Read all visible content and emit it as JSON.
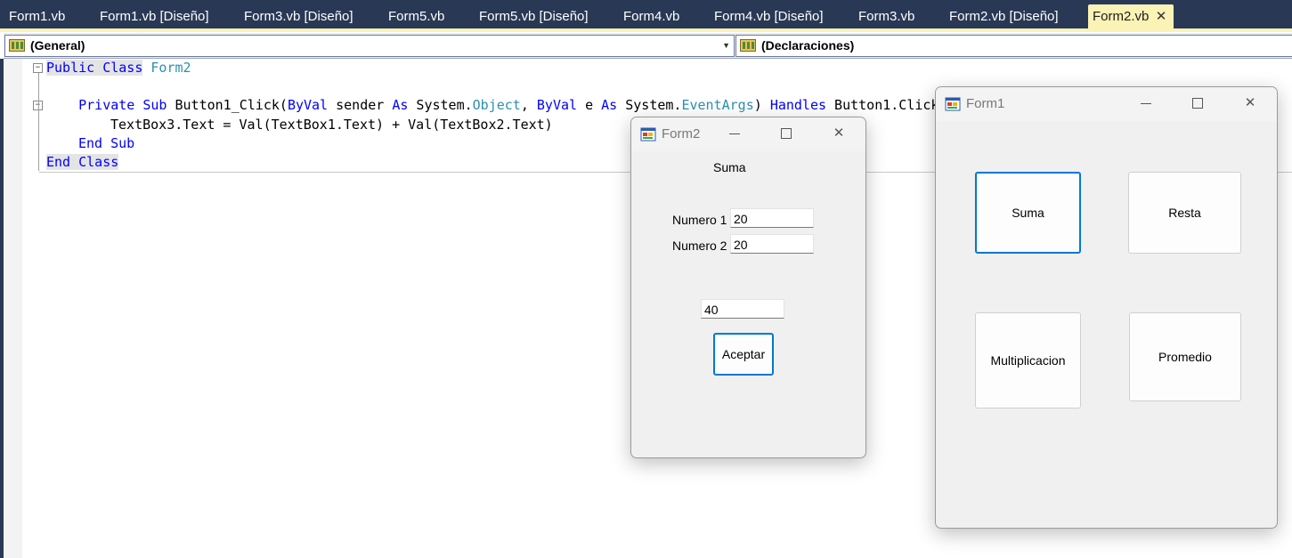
{
  "tabs": [
    {
      "label": "Form1.vb"
    },
    {
      "label": "Form1.vb [Diseño]"
    },
    {
      "label": "Form3.vb [Diseño]"
    },
    {
      "label": "Form5.vb"
    },
    {
      "label": "Form5.vb [Diseño]"
    },
    {
      "label": "Form4.vb"
    },
    {
      "label": "Form4.vb [Diseño]"
    },
    {
      "label": "Form3.vb"
    },
    {
      "label": "Form2.vb [Diseño]"
    },
    {
      "label": "Form2.vb",
      "close": "✕"
    }
  ],
  "navbar": {
    "left_combo": "(General)",
    "right_combo": "(Declaraciones)",
    "arrow": "▼"
  },
  "code": {
    "l1": {
      "kw1": "Public",
      "kw2": "Class",
      "type": "Form2"
    },
    "l3": {
      "kw1": "Private",
      "kw2": "Sub",
      "t1": " Button1_Click(",
      "kw3": "ByVal",
      "t2": " sender ",
      "kw4": "As",
      "t3": " System.",
      "ty1": "Object",
      "t4": ", ",
      "kw5": "ByVal",
      "t5": " e ",
      "kw6": "As",
      "t6": " System.",
      "ty2": "EventArgs",
      "t7": ") ",
      "kw7": "Handles",
      "t8": " Button1.Click"
    },
    "l4": "TextBox3.Text = Val(TextBox1.Text) + Val(TextBox2.Text)",
    "l5": {
      "kw1": "End",
      "kw2": "Sub"
    },
    "l6": {
      "kw1": "End",
      "kw2": "Class"
    },
    "fold_minus": "−"
  },
  "form2": {
    "title": "Form2",
    "heading": "Suma",
    "label1": "Numero 1",
    "value1": "20",
    "label2": "Numero 2",
    "value2": "20",
    "result": "40",
    "button": "Aceptar"
  },
  "form1": {
    "title": "Form1",
    "buttons": {
      "suma": "Suma",
      "resta": "Resta",
      "multiplicacion": "Multiplicacion",
      "promedio": "Promedio"
    }
  },
  "window_controls": {
    "close": "✕"
  },
  "colors": {
    "keyword": "#0000ff",
    "type": "#2b91af",
    "tab_active": "#fbf2b6",
    "tabstrip": "#293955",
    "focus": "#0078d4"
  }
}
